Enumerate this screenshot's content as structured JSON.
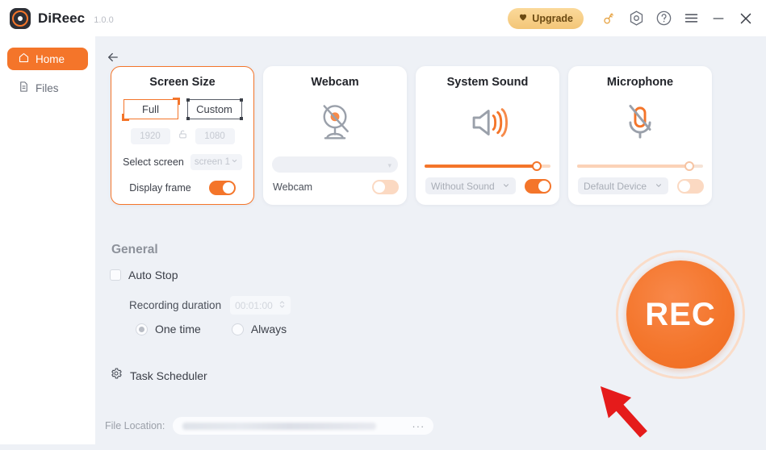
{
  "app": {
    "name": "DiReec",
    "version": "1.0.0",
    "logo_icon": "record-logo-icon"
  },
  "titlebar": {
    "upgrade_label": "Upgrade",
    "upgrade_icon": "heart-icon",
    "key_icon": "key-icon",
    "settings_icon": "gear-hex-icon",
    "help_icon": "help-circle-icon",
    "menu_icon": "hamburger-menu-icon",
    "minimize_icon": "minimize-icon",
    "close_icon": "close-icon",
    "upgrade_color": "#f3c678"
  },
  "sidebar": {
    "items": [
      {
        "label": "Home",
        "icon": "home-icon",
        "active": true
      },
      {
        "label": "Files",
        "icon": "file-icon",
        "active": false
      }
    ]
  },
  "content": {
    "back_icon": "back-arrow-icon"
  },
  "cards": {
    "screen_size": {
      "title": "Screen Size",
      "full_label": "Full",
      "custom_label": "Custom",
      "selected_mode": "Full",
      "width_value": "1920",
      "height_value": "1080",
      "lock_icon": "unlocked-padlock-icon",
      "select_screen_label": "Select screen",
      "screen_value": "screen 1",
      "display_frame_label": "Display frame",
      "display_frame_on": true
    },
    "webcam": {
      "title": "Webcam",
      "icon": "webcam-disabled-icon",
      "device_value": "",
      "label": "Webcam",
      "toggle_on": false
    },
    "system_sound": {
      "title": "System Sound",
      "icon": "speaker-icon",
      "volume_percent": 90,
      "device_value": "Without Sound",
      "toggle_on": true
    },
    "microphone": {
      "title": "Microphone",
      "icon": "microphone-muted-icon",
      "volume_percent": 90,
      "device_value": "Default Device",
      "toggle_on": false
    }
  },
  "general": {
    "title": "General",
    "auto_stop_label": "Auto Stop",
    "auto_stop_checked": false,
    "recording_duration_label": "Recording duration",
    "recording_duration_value": "00:01:00",
    "one_time_label": "One time",
    "always_label": "Always",
    "selected_repeat": "One time",
    "task_scheduler_label": "Task Scheduler",
    "task_scheduler_icon": "gear-icon"
  },
  "file_location": {
    "label": "File Location:",
    "path_value": "",
    "browse_label": "···"
  },
  "record": {
    "label": "REC",
    "color": "#f4752a",
    "annotation_arrow": "red-arrow-annotation"
  },
  "theme": {
    "accent": "#f4752a",
    "accent_light": "#fbd9c2",
    "background": "#eef1f6",
    "card": "#ffffff"
  }
}
